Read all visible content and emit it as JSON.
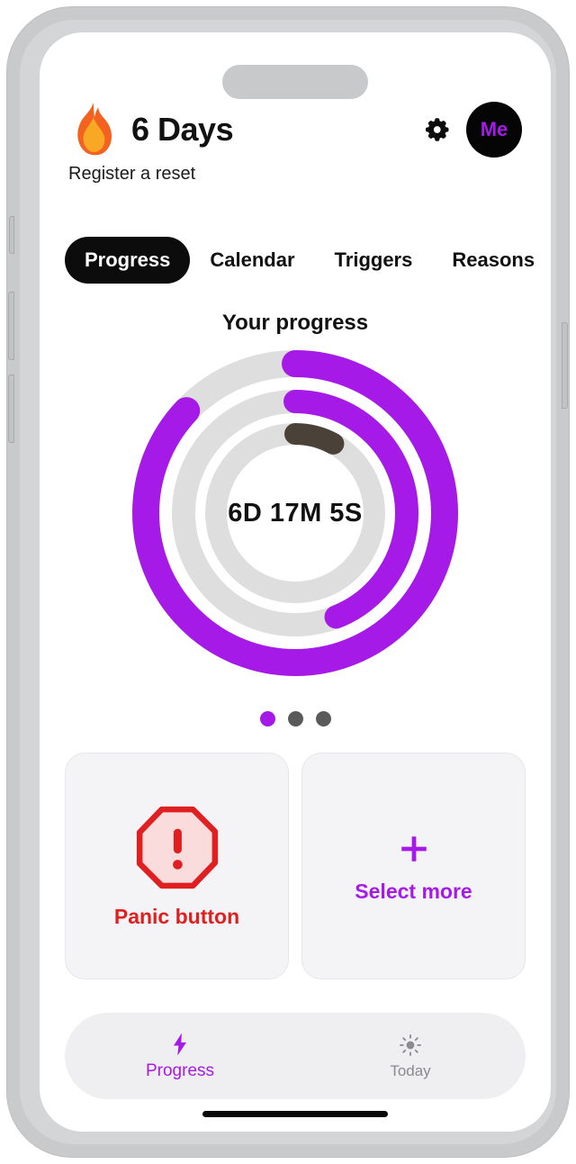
{
  "app": {
    "accent_purple": "#a61ae8",
    "danger_red": "#e02020",
    "ring_track_gray": "#dedede",
    "ring_inner_dark": "#4a4238",
    "frame_gray": "#c9cacb"
  },
  "header": {
    "flame_icon": "flame-icon",
    "streak_title": "6 Days",
    "subtitle": "Register a reset",
    "gear_icon": "gear-icon",
    "avatar_label": "Me"
  },
  "tabs": [
    {
      "label": "Progress",
      "active": true
    },
    {
      "label": "Calendar",
      "active": false
    },
    {
      "label": "Triggers",
      "active": false
    },
    {
      "label": "Reasons",
      "active": false
    }
  ],
  "progress": {
    "section_title": "Your progress",
    "center_label": "6D 17M 5S"
  },
  "chart_data": {
    "type": "pie",
    "title": "Your progress",
    "center_label": "6D 17M 5S",
    "legend_position": "none",
    "grid": false,
    "series": [
      {
        "name": "Outer ring",
        "radius": 170,
        "stroke_width": 30,
        "percent": 87,
        "color": "#a61ae8",
        "track_color": "#dedede"
      },
      {
        "name": "Middle ring",
        "radius": 128,
        "stroke_width": 26,
        "percent": 44,
        "color": "#a61ae8",
        "track_color": "#dedede"
      },
      {
        "name": "Inner ring",
        "radius": 92,
        "stroke_width": 24,
        "percent": 8,
        "color": "#4a4238",
        "track_color": "#dedede"
      }
    ]
  },
  "pager": {
    "count": 3,
    "active_index": 0
  },
  "cards": [
    {
      "name": "panic-button",
      "icon": "octagon-alert-icon",
      "label": "Panic button",
      "color": "#e02020"
    },
    {
      "name": "select-more",
      "icon": "plus-icon",
      "label": "Select more",
      "color": "#a61ae8"
    }
  ],
  "bottom_nav": [
    {
      "label": "Progress",
      "icon": "lightning-bolt-icon",
      "active": true
    },
    {
      "label": "Today",
      "icon": "sun-icon",
      "active": false
    }
  ]
}
